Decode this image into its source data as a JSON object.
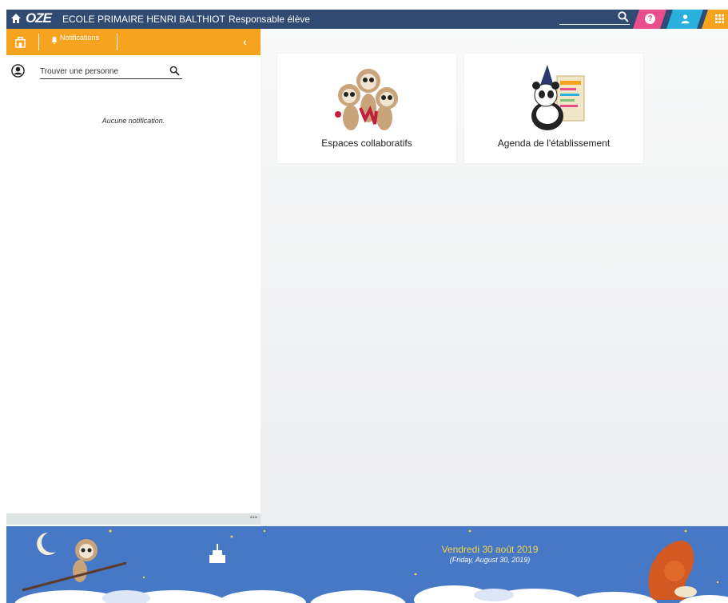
{
  "header": {
    "logo": "OZE",
    "school": "ECOLE PRIMAIRE HENRI BALTHIOT",
    "role": "Responsable élève"
  },
  "left_panel": {
    "tab_notifications": "Notifications",
    "search_placeholder": "Trouver une personne",
    "empty_message": "Aucune notification.",
    "more": "•••"
  },
  "main": {
    "cards": [
      {
        "label": "Espaces collaboratifs"
      },
      {
        "label": "Agenda de l'établissement"
      }
    ]
  },
  "footer": {
    "date": "Vendredi 30 août 2019",
    "date_en": "(Friday, August 30, 2019)"
  },
  "colors": {
    "topbar": "#2f4a73",
    "accent_orange": "#f6a31f",
    "help_pink": "#e94f8a",
    "user_blue": "#29b0dd",
    "footer_blue": "#4778c6"
  }
}
